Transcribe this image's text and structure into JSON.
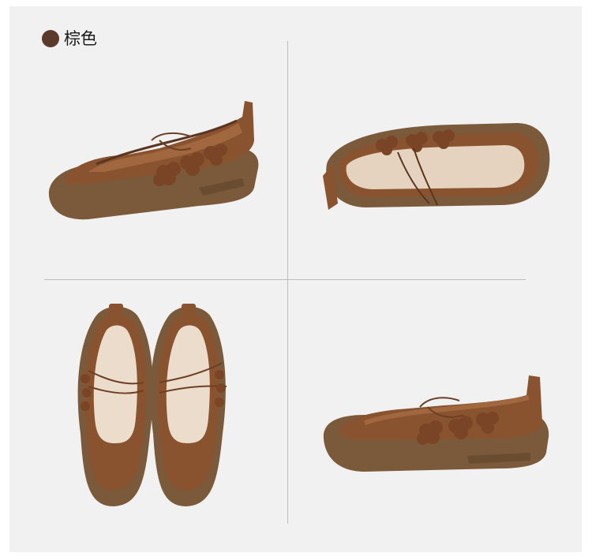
{
  "color_option": {
    "label": "棕色",
    "swatch_color": "#5a3a2b"
  },
  "product_views": [
    {
      "view": "side-view-left",
      "icon": "shoe-photo"
    },
    {
      "view": "top-angle-view",
      "icon": "shoe-photo"
    },
    {
      "view": "pair-top-view",
      "icon": "shoe-photo"
    },
    {
      "view": "side-view-right",
      "icon": "shoe-photo"
    }
  ],
  "palette": {
    "background": "#f1f1f1",
    "leather": "#8a5330",
    "leather_light": "#b0764a",
    "sole": "#7a5a3a",
    "insole": "#ecdccb"
  }
}
